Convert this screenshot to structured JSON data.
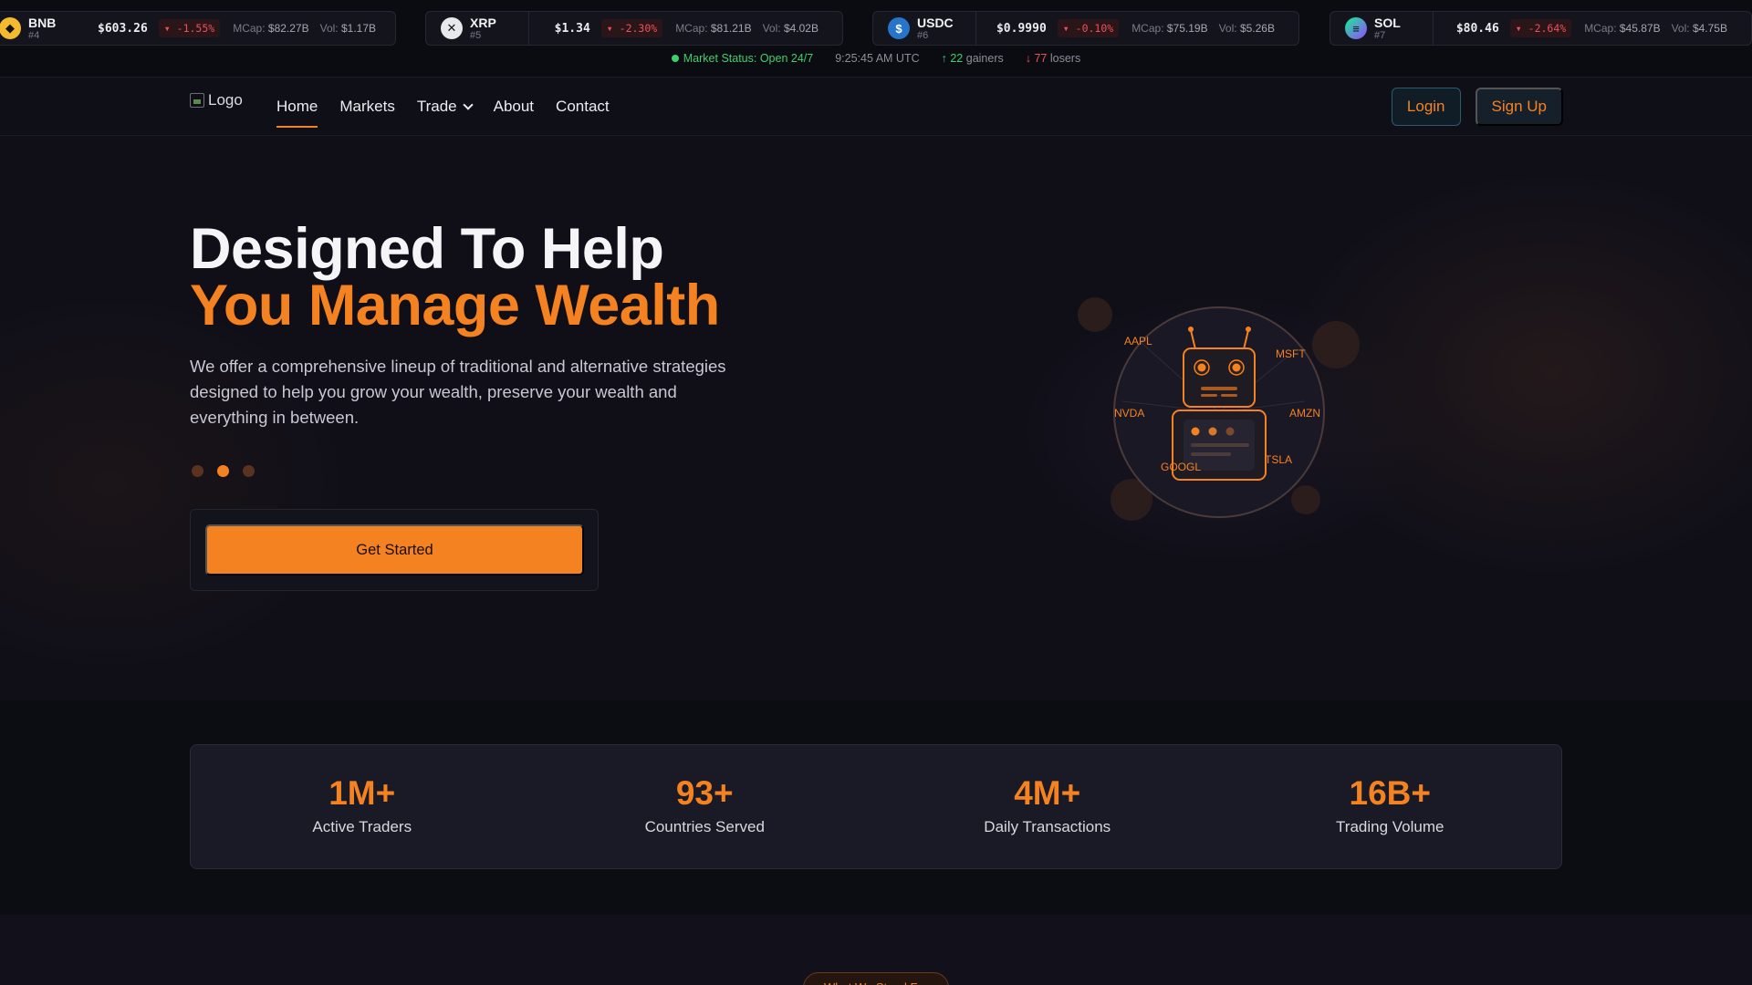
{
  "ticker": {
    "coins": [
      {
        "symbol": "BNB",
        "rank": "#4",
        "price": "$603.26",
        "change": "-1.55%",
        "mcap_label": "MCap:",
        "mcap": "$82.27B",
        "vol_label": "Vol:",
        "vol": "$1.17B",
        "icon": "bnb-coin-icon",
        "color": "#f3ba2f"
      },
      {
        "symbol": "XRP",
        "rank": "#5",
        "price": "$1.34",
        "change": "-2.30%",
        "mcap_label": "MCap:",
        "mcap": "$81.21B",
        "vol_label": "Vol:",
        "vol": "$4.02B",
        "icon": "xrp-coin-icon",
        "color": "#e8e8ec"
      },
      {
        "symbol": "USDC",
        "rank": "#6",
        "price": "$0.9990",
        "change": "-0.10%",
        "mcap_label": "MCap:",
        "mcap": "$75.19B",
        "vol_label": "Vol:",
        "vol": "$5.26B",
        "icon": "usdc-coin-icon",
        "color": "#2775ca"
      },
      {
        "symbol": "SOL",
        "rank": "#7",
        "price": "$80.46",
        "change": "-2.64%",
        "mcap_label": "MCap:",
        "mcap": "$45.87B",
        "vol_label": "Vol:",
        "vol": "$4.75B",
        "icon": "sol-coin-icon",
        "color": "#9945ff"
      }
    ],
    "status": {
      "market": "Market Status: Open 24/7",
      "time": "9:25:45 AM UTC",
      "gainers_count": "22",
      "gainers_label": "gainers",
      "losers_count": "77",
      "losers_label": "losers"
    }
  },
  "nav": {
    "logo_alt": "Logo",
    "links": [
      "Home",
      "Markets",
      "Trade",
      "About",
      "Contact"
    ],
    "active": "Home",
    "login": "Login",
    "signup": "Sign Up"
  },
  "hero": {
    "title_line1": "Designed To Help",
    "title_line2": "You Manage Wealth",
    "description": "We offer a comprehensive lineup of traditional and alternative strategies designed to help you grow your wealth, preserve your wealth and everything in between.",
    "carousel_active_index": 1,
    "cta": "Get Started",
    "illustration_labels": [
      "AAPL",
      "MSFT",
      "NVDA",
      "AMZN",
      "TSLA",
      "GOOGL"
    ]
  },
  "stats": [
    {
      "value": "1M+",
      "label": "Active Traders"
    },
    {
      "value": "93+",
      "label": "Countries Served"
    },
    {
      "value": "4M+",
      "label": "Daily Transactions"
    },
    {
      "value": "16B+",
      "label": "Trading Volume"
    }
  ],
  "section_pill": "What We Stand For",
  "colors": {
    "accent": "#f58220",
    "up": "#3ecf6e",
    "down": "#f0505a",
    "background": "#0f0f17"
  }
}
